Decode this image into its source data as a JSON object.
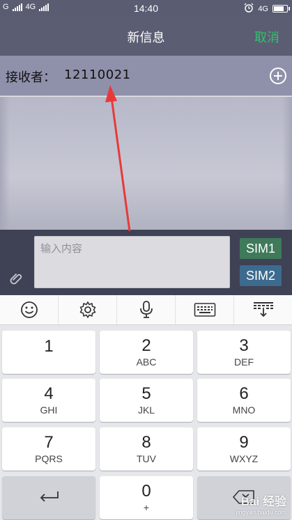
{
  "status_bar": {
    "carrier1": "G",
    "carrier2": "4G",
    "time": "14:40",
    "network_right": "4G"
  },
  "header": {
    "title": "新信息",
    "cancel_label": "取消"
  },
  "recipient": {
    "label": "接收者：",
    "value": "12110021"
  },
  "compose": {
    "placeholder": "输入内容",
    "sim1_label": "SIM1",
    "sim2_label": "SIM2"
  },
  "keyboard_toolbar": {
    "icons": [
      "emoji-icon",
      "gear-icon",
      "microphone-icon",
      "keyboard-icon",
      "keyboard-collapse-icon"
    ]
  },
  "keypad": {
    "keys": [
      {
        "digit": "1",
        "letters": ""
      },
      {
        "digit": "2",
        "letters": "ABC"
      },
      {
        "digit": "3",
        "letters": "DEF"
      },
      {
        "digit": "4",
        "letters": "GHI"
      },
      {
        "digit": "5",
        "letters": "JKL"
      },
      {
        "digit": "6",
        "letters": "MNO"
      },
      {
        "digit": "7",
        "letters": "PQRS"
      },
      {
        "digit": "8",
        "letters": "TUV"
      },
      {
        "digit": "9",
        "letters": "WXYZ"
      },
      {
        "digit": "0",
        "letters": "+"
      }
    ]
  },
  "watermark": {
    "line1": "Bai 经验",
    "line2": "jingyan.baidu.com"
  },
  "colors": {
    "accent_green": "#2fc46a",
    "sim1": "#3f7a5a",
    "sim2": "#3d6b8e",
    "header": "#5b5d72",
    "arrow": "#e8393a"
  }
}
